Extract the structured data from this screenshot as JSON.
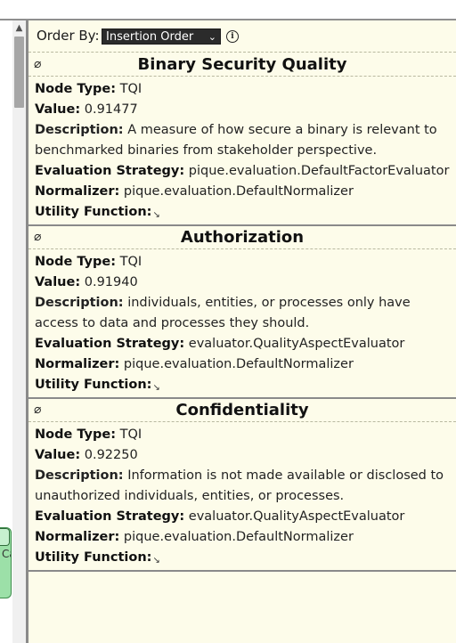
{
  "toolbar": {
    "order_label": "Order By:",
    "order_value": "Insertion Order",
    "chevron": "⌄",
    "info_icon": "i"
  },
  "canvas": {
    "node_fragment": "Ca"
  },
  "labels": {
    "node_type": "Node Type:",
    "value": "Value:",
    "description": "Description:",
    "evaluation_strategy": "Evaluation Strategy:",
    "normalizer": "Normalizer:",
    "utility_function": "Utility Function:"
  },
  "nodes": [
    {
      "title": "Binary Security Quality",
      "node_type": "TQI",
      "value": "0.91477",
      "description": "A measure of how secure a binary is relevant to benchmarked binaries from stakeholder perspective.",
      "evaluation_strategy": "pique.evaluation.DefaultFactorEvaluator",
      "normalizer": "pique.evaluation.DefaultNormalizer",
      "utility_function": "↘"
    },
    {
      "title": "Authorization",
      "node_type": "TQI",
      "value": "0.91940",
      "description": "individuals, entities, or processes only have access to data and processes they should.",
      "evaluation_strategy": "evaluator.QualityAspectEvaluator",
      "normalizer": "pique.evaluation.DefaultNormalizer",
      "utility_function": "↘"
    },
    {
      "title": "Confidentiality",
      "node_type": "TQI",
      "value": "0.92250",
      "description": "Information is not made available or disclosed to unauthorized individuals, entities, or processes.",
      "evaluation_strategy": "evaluator.QualityAspectEvaluator",
      "normalizer": "pique.evaluation.DefaultNormalizer",
      "utility_function": "↘"
    }
  ],
  "icons": {
    "hide": "⌀",
    "scroll_up": "▲"
  }
}
